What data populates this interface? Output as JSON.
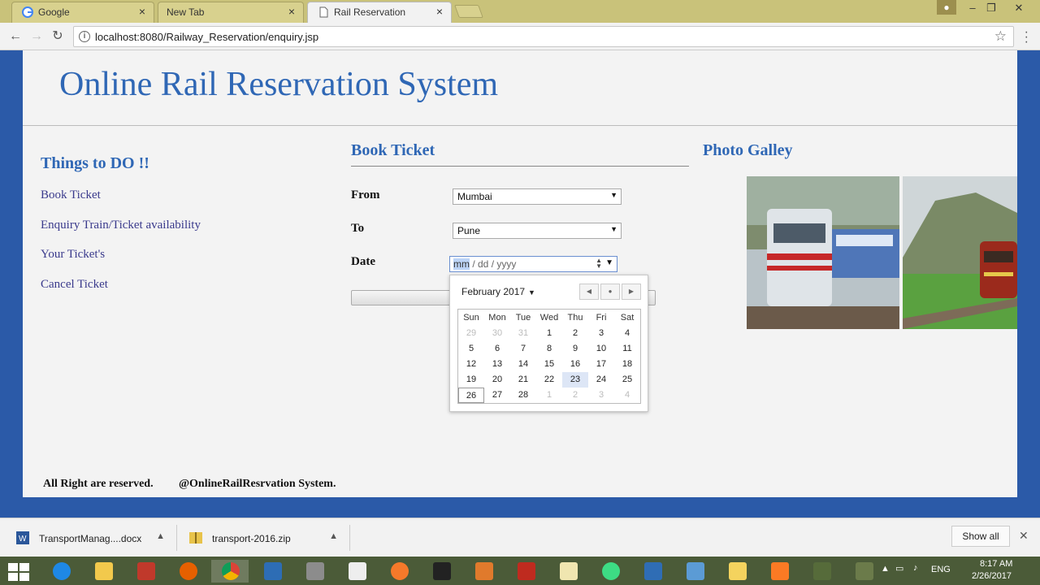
{
  "browser": {
    "tabs": [
      {
        "title": "Google",
        "active": false
      },
      {
        "title": "New Tab",
        "active": false
      },
      {
        "title": "Rail Reservation",
        "active": true
      }
    ],
    "url": "localhost:8080/Railway_Reservation/enquiry.jsp"
  },
  "site": {
    "title": "Online Rail Reservation System"
  },
  "sidebar": {
    "heading": "Things to DO !!",
    "links": [
      "Book Ticket",
      "Enquiry Train/Ticket availability",
      "Your Ticket's",
      "Cancel Ticket"
    ]
  },
  "booking": {
    "heading": "Book Ticket",
    "from_label": "From",
    "from_value": "Mumbai",
    "to_label": "To",
    "to_value": "Pune",
    "date_label": "Date",
    "date_placeholder_mm": "mm",
    "date_placeholder_rest": "/ dd / yyyy"
  },
  "datepicker": {
    "month": "February 2017",
    "weekdays": [
      "Sun",
      "Mon",
      "Tue",
      "Wed",
      "Thu",
      "Fri",
      "Sat"
    ],
    "weeks": [
      [
        "29",
        "30",
        "31",
        "1",
        "2",
        "3",
        "4"
      ],
      [
        "5",
        "6",
        "7",
        "8",
        "9",
        "10",
        "11"
      ],
      [
        "12",
        "13",
        "14",
        "15",
        "16",
        "17",
        "18"
      ],
      [
        "19",
        "20",
        "21",
        "22",
        "23",
        "24",
        "25"
      ],
      [
        "26",
        "27",
        "28",
        "1",
        "2",
        "3",
        "4"
      ]
    ],
    "today": "26",
    "hovered": "23"
  },
  "gallery": {
    "heading": "Photo Galley"
  },
  "footer": {
    "rights": "All Right are reserved.",
    "credit": "@OnlineRailResrvation System."
  },
  "downloads": {
    "items": [
      "TransportManag....docx",
      "transport-2016.zip"
    ],
    "show_all": "Show all"
  },
  "taskbar": {
    "language": "ENG",
    "time": "8:17 AM",
    "date": "2/26/2017"
  }
}
